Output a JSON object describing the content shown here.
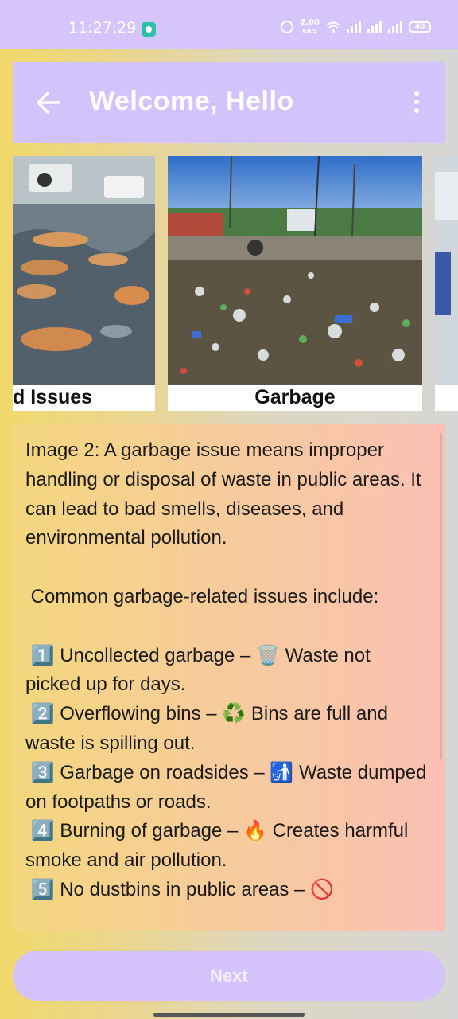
{
  "status_bar": {
    "time": "11:27:29",
    "network_speed_value": "2.00",
    "network_speed_unit": "KB/S",
    "battery_level": "40"
  },
  "app_bar": {
    "title": "Welcome, Hello",
    "back_icon": "arrow-left-icon",
    "menu_icon": "more-vert-icon"
  },
  "carousel": {
    "items": [
      {
        "label": "d Issues"
      },
      {
        "label": "Garbage"
      }
    ]
  },
  "description": {
    "text": "Image 2: A garbage issue means improper handling or disposal of waste in public areas. It can lead to bad smells, diseases, and environmental pollution.\n\n Common garbage-related issues include:\n\n 1️⃣ Uncollected garbage – 🗑️ Waste not picked up for days.\n 2️⃣ Overflowing bins – ♻️ Bins are full and waste is spilling out.\n 3️⃣ Garbage on roadsides – 🚮 Waste dumped on footpaths or roads.\n 4️⃣ Burning of garbage – 🔥 Creates harmful smoke and air pollution.\n 5️⃣ No dustbins in public areas – 🚫"
  },
  "next_button": {
    "label": "Next"
  },
  "colors": {
    "accent": "#d3c3fb",
    "status_bar": "#d5c5fa"
  }
}
